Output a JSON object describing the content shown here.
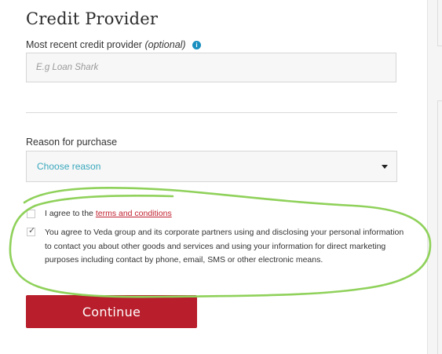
{
  "form": {
    "title": "Credit Provider",
    "credit_provider": {
      "label": "Most recent credit provider",
      "optional": "(optional)",
      "info_icon": "info-icon",
      "placeholder": "E.g Loan Shark",
      "value": ""
    },
    "reason": {
      "label": "Reason for purchase",
      "selected": "Choose reason",
      "caret_icon": "caret-down-icon"
    },
    "consent": {
      "terms_prefix": "I agree to the",
      "terms_link": "terms and conditions",
      "terms_checked": false,
      "marketing_text": "You agree to Veda group and its corporate partners using and disclosing your personal information to contact you about other goods and services and using your information for direct marketing purposes including contact by phone, email, SMS or other electronic means.",
      "marketing_checked": true
    },
    "continue_label": "Continue"
  },
  "colors": {
    "accent": "#b81e2b",
    "link": "#c0212f",
    "select_text": "#3aa8bd",
    "info": "#1a8fbf",
    "annotation_outline": "#8fd15a"
  }
}
